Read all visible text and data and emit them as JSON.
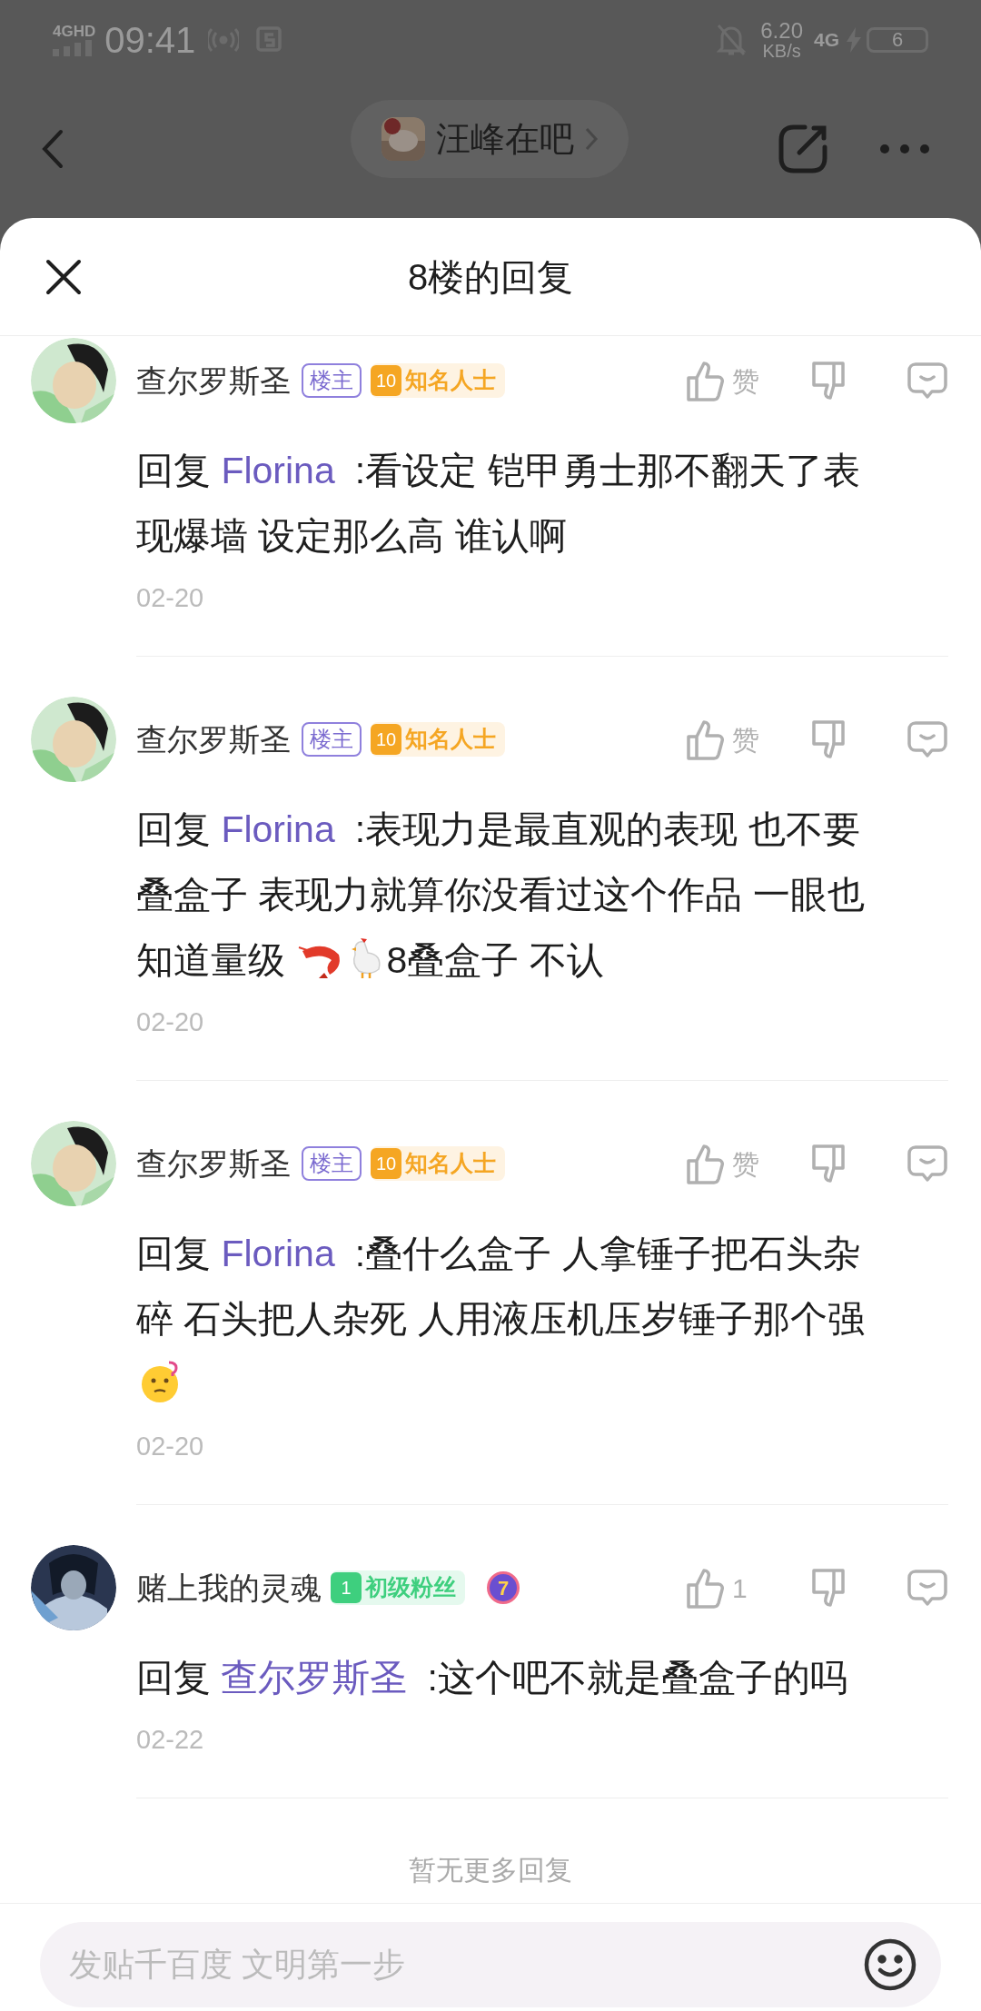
{
  "status_bar": {
    "network": "4GHD",
    "time": "09:41",
    "speed": "6.20",
    "speed_unit": "KB/s",
    "mobile": "4G",
    "battery": "6"
  },
  "header": {
    "forum": "汪峰在吧"
  },
  "sheet": {
    "title": "8楼的回复"
  },
  "comments": [
    {
      "author": "查尔罗斯圣",
      "op_badge": "楼主",
      "fan_badge": {
        "level": "10",
        "title": "知名人士",
        "color": "#f5a623"
      },
      "like": "赞",
      "reply": {
        "prefix": "回复",
        "target": "Florina",
        "segments": [
          {
            "kind": "text",
            "text": ":看设定 铠甲勇士那不翻天了表现爆墙 设定那么高 谁认啊"
          }
        ]
      },
      "date": "02-20"
    },
    {
      "author": "查尔罗斯圣",
      "op_badge": "楼主",
      "fan_badge": {
        "level": "10",
        "title": "知名人士",
        "color": "#f5a623"
      },
      "like": "赞",
      "reply": {
        "prefix": "回复",
        "target": "Florina",
        "segments": [
          {
            "kind": "text",
            "text": ":表现力是最直观的表现 也不要叠盒子 表现力就算你没看过这个作品 一眼也知道量级 "
          },
          {
            "kind": "shrimp"
          },
          {
            "kind": "chicken"
          },
          {
            "kind": "text",
            "text": "8叠盒子 不认"
          }
        ]
      },
      "date": "02-20"
    },
    {
      "author": "查尔罗斯圣",
      "op_badge": "楼主",
      "fan_badge": {
        "level": "10",
        "title": "知名人士",
        "color": "#f5a623"
      },
      "like": "赞",
      "reply": {
        "prefix": "回复",
        "target": "Florina",
        "segments": [
          {
            "kind": "text",
            "text": ":叠什么盒子 人拿锤子把石头杂碎 石头把人杂死 人用液压机压岁锤子那个强"
          },
          {
            "kind": "thinking"
          }
        ]
      },
      "date": "02-20"
    },
    {
      "author": "赌上我的灵魂",
      "fan_badge": {
        "level": "1",
        "title": "初级粉丝",
        "color": "#3ecf7e"
      },
      "medal": "7",
      "like": "1",
      "reply": {
        "prefix": "回复",
        "target": "查尔罗斯圣",
        "segments": [
          {
            "kind": "text",
            "text": ":这个吧不就是叠盒子的吗"
          }
        ]
      },
      "date": "02-22"
    }
  ],
  "end_note": "暂无更多回复",
  "composer": {
    "placeholder": "发贴千百度 文明第一步"
  }
}
